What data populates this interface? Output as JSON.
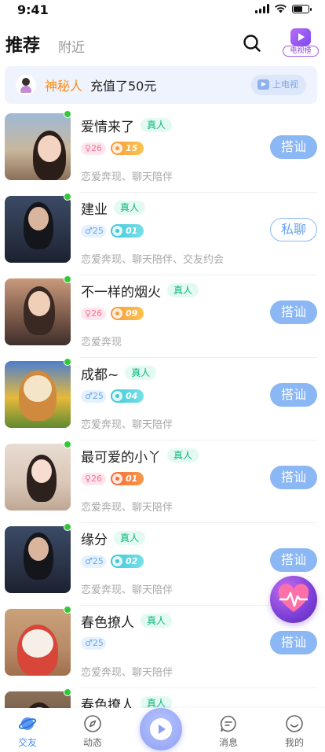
{
  "status_bar": {
    "time": "9:41",
    "battery_level": 0.6
  },
  "header": {
    "tabs": [
      {
        "label": "推荐",
        "active": true
      },
      {
        "label": "附近",
        "active": false
      }
    ],
    "search_icon": "search-icon",
    "tv_label": "电视榜"
  },
  "banner": {
    "name": "神秘人",
    "text": "充值了50元",
    "button_label": "上电视"
  },
  "users": [
    {
      "name": "爱情来了",
      "real_label": "真人",
      "gender": "female",
      "age": "26",
      "level": "15",
      "level_color": "orange",
      "tags": "恋爱奔现、聊天陪伴",
      "action": "搭讪",
      "action_style": "fill",
      "online": true
    },
    {
      "name": "建业",
      "real_label": "真人",
      "gender": "male",
      "age": "25",
      "level": "01",
      "level_color": "teal",
      "tags": "恋爱奔现、聊天陪伴、交友约会",
      "action": "私聊",
      "action_style": "outline",
      "online": true
    },
    {
      "name": "不一样的烟火",
      "real_label": "真人",
      "gender": "female",
      "age": "26",
      "level": "09",
      "level_color": "orange",
      "tags": "恋爱奔现",
      "action": "搭讪",
      "action_style": "fill",
      "online": true
    },
    {
      "name": "成都~",
      "real_label": "真人",
      "gender": "male",
      "age": "25",
      "level": "04",
      "level_color": "teal",
      "tags": "恋爱奔现、聊天陪伴",
      "action": "搭讪",
      "action_style": "fill",
      "online": true
    },
    {
      "name": "最可爱的小丫",
      "real_label": "真人",
      "gender": "female",
      "age": "26",
      "level": "01",
      "level_color": "orangered",
      "tags": "恋爱奔现、聊天陪伴",
      "action": "搭讪",
      "action_style": "fill",
      "online": true
    },
    {
      "name": "缘分",
      "real_label": "真人",
      "gender": "male",
      "age": "25",
      "level": "02",
      "level_color": "teal",
      "tags": "恋爱奔现、聊天陪伴",
      "action": "搭讪",
      "action_style": "fill",
      "online": true
    },
    {
      "name": "春色撩人",
      "real_label": "真人",
      "gender": "male",
      "age": "25",
      "level": "",
      "level_color": "",
      "tags": "恋爱奔现、聊天陪伴",
      "action": "搭讪",
      "action_style": "fill",
      "online": true
    },
    {
      "name": "春色撩人",
      "real_label": "真人",
      "gender": "",
      "age": "",
      "level": "",
      "level_color": "",
      "tags": "",
      "action": "",
      "action_style": "",
      "online": true
    }
  ],
  "bottom_nav": {
    "items": [
      {
        "label": "交友",
        "icon": "planet-icon",
        "active": true
      },
      {
        "label": "动态",
        "icon": "compass-icon",
        "active": false
      },
      {
        "label": "消息",
        "icon": "message-icon",
        "active": false
      },
      {
        "label": "我的",
        "icon": "smile-icon",
        "active": false
      }
    ],
    "center_icon": "play-icon"
  },
  "colors": {
    "accent": "#4c8ef0",
    "action_fill": "#8bb7f4",
    "real_tag": "#12b47e",
    "online": "#35c73a",
    "banner_name": "#ff8c1a"
  }
}
